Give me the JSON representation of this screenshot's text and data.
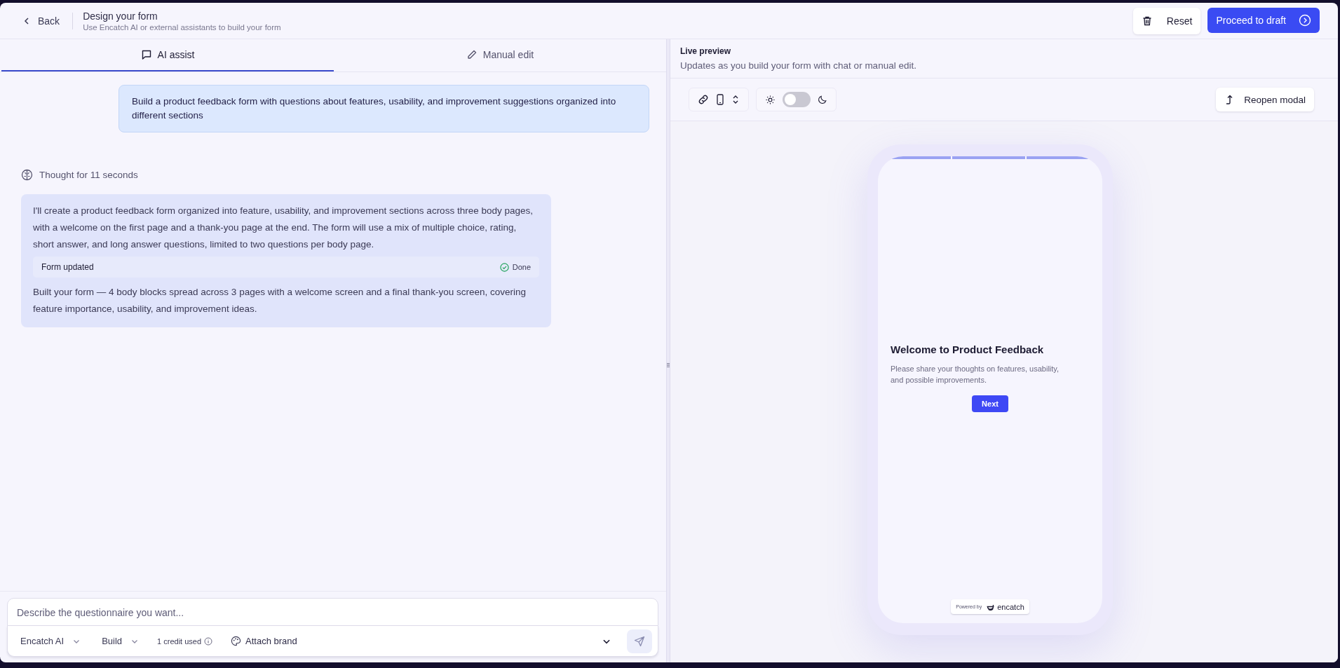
{
  "header": {
    "back": "Back",
    "title": "Design your form",
    "subtitle": "Use Encatch AI or external assistants to build your form",
    "actions": [
      {
        "label": "Reset",
        "kind": "secondary"
      },
      {
        "label": "Proceed to draft",
        "kind": "primary"
      }
    ]
  },
  "tabs": [
    {
      "label": "AI assist",
      "selected": true,
      "kind": "chat"
    },
    {
      "label": "Manual edit",
      "selected": false,
      "kind": "edit"
    }
  ],
  "chat": {
    "user_message": "Build a product feedback form with questions about features, usability, and improvement suggestions organized into different sections",
    "thought": "Thought for 11 seconds",
    "reply": {
      "intro": "I'll create a product feedback form organized into feature, usability, and improvement sections across three body pages, with a welcome on the first page and a thank-you page at the end. The form will use a mix of multiple choice, rating, short answer, and long answer questions, limited to two questions per body page.",
      "status": {
        "label": "Form updated",
        "state": "Done"
      },
      "summary": "Built your form — 4 body blocks spread across 3 pages with a welcome screen and a final thank-you screen, covering feature importance, usability, and improvement ideas."
    }
  },
  "composer": {
    "placeholder": "Describe the questionnaire you want...",
    "model": "Encatch AI",
    "mode": "Build",
    "credits": "1 credit used",
    "attach": "Attach brand"
  },
  "preview": {
    "title": "Live preview",
    "subtitle": "Updates as you build your form with chat or manual edit.",
    "theme_toggle": {
      "on": false
    },
    "reopen": "Reopen modal",
    "form": {
      "title": "Welcome to Product Feedback",
      "description": "Please share your thoughts on features, usability, and possible improvements.",
      "button": "Next",
      "powered_by": "Powered by",
      "brand": "encatch"
    }
  }
}
